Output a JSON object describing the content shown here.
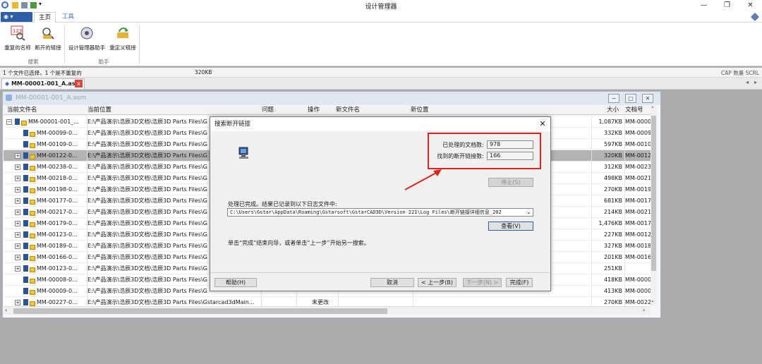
{
  "window": {
    "title": "设计管理器",
    "min": "—",
    "max": "❐",
    "close": "✕"
  },
  "ribbon": {
    "tabs": [
      "主页",
      "工具"
    ],
    "buttons": [
      "重复的名称",
      "断开的链接",
      "设计管理器助手",
      "重定义链接"
    ],
    "groups": [
      "搜索",
      "助手"
    ]
  },
  "status": {
    "selection": "1 个文件已选择，1 个是不重复的",
    "size": "320KB",
    "indicators": "CAP 数量 SCRL"
  },
  "doc_tab": {
    "label": "MM-00001-001_A.asm",
    "close": "x"
  },
  "inner_window": {
    "title": "MM-00001-001_A.asm"
  },
  "columns": [
    "当前文件名",
    "当前位置",
    "问题",
    "操作",
    "新文件名",
    "新位置",
    "大小",
    "文档号"
  ],
  "rows": [
    {
      "name": "MM-00001-001_...",
      "location": "E:\\产品演示\\浩辰3D文档\\浩辰3D Parts Files\\G",
      "action": "",
      "size": "1,087KB",
      "doc": "MM-0000",
      "indent": 0,
      "exp": "−",
      "sel": false
    },
    {
      "name": "MM-00099-0...",
      "location": "E:\\产品演示\\浩辰3D文档\\浩辰3D Parts Files\\G",
      "action": "",
      "size": "332KB",
      "doc": "MM-0009",
      "indent": 1,
      "exp": "",
      "sel": false
    },
    {
      "name": "MM-00109-0...",
      "location": "E:\\产品演示\\浩辰3D文档\\浩辰3D Parts Files\\G",
      "action": "",
      "size": "597KB",
      "doc": "MM-0010",
      "indent": 1,
      "exp": "",
      "sel": false
    },
    {
      "name": "MM-00122-0...",
      "location": "E:\\产品演示\\浩辰3D文档\\浩辰3D Parts Files\\G",
      "action": "",
      "size": "320KB",
      "doc": "MM-0012",
      "indent": 1,
      "exp": "+",
      "sel": true
    },
    {
      "name": "MM-00238-0...",
      "location": "E:\\产品演示\\浩辰3D文档\\浩辰3D Parts Files\\G",
      "action": "",
      "size": "312KB",
      "doc": "MM-0023",
      "indent": 1,
      "exp": "+",
      "sel": false
    },
    {
      "name": "MM-00218-0...",
      "location": "E:\\产品演示\\浩辰3D文档\\浩辰3D Parts Files\\G",
      "action": "",
      "size": "498KB",
      "doc": "MM-0021",
      "indent": 1,
      "exp": "+",
      "sel": false
    },
    {
      "name": "MM-00198-0...",
      "location": "E:\\产品演示\\浩辰3D文档\\浩辰3D Parts Files\\G",
      "action": "",
      "size": "270KB",
      "doc": "MM-0019",
      "indent": 1,
      "exp": "+",
      "sel": false
    },
    {
      "name": "MM-00177-0...",
      "location": "E:\\产品演示\\浩辰3D文档\\浩辰3D Parts Files\\G",
      "action": "",
      "size": "681KB",
      "doc": "MM-0017",
      "indent": 1,
      "exp": "+",
      "sel": false
    },
    {
      "name": "MM-00217-0...",
      "location": "E:\\产品演示\\浩辰3D文档\\浩辰3D Parts Files\\G",
      "action": "",
      "size": "214KB",
      "doc": "MM-0021",
      "indent": 1,
      "exp": "+",
      "sel": false
    },
    {
      "name": "MM-00179-0...",
      "location": "E:\\产品演示\\浩辰3D文档\\浩辰3D Parts Files\\G",
      "action": "",
      "size": "1,476KB",
      "doc": "MM-0017",
      "indent": 1,
      "exp": "+",
      "sel": false
    },
    {
      "name": "MM-00123-0...",
      "location": "E:\\产品演示\\浩辰3D文档\\浩辰3D Parts Files\\G",
      "action": "",
      "size": "227KB",
      "doc": "MM-0012",
      "indent": 1,
      "exp": "+",
      "sel": false
    },
    {
      "name": "MM-00189-0...",
      "location": "E:\\产品演示\\浩辰3D文档\\浩辰3D Parts Files\\G",
      "action": "",
      "size": "327KB",
      "doc": "MM-0018",
      "indent": 1,
      "exp": "+",
      "sel": false
    },
    {
      "name": "MM-00166-0...",
      "location": "E:\\产品演示\\浩辰3D文档\\浩辰3D Parts Files\\G",
      "action": "",
      "size": "201KB",
      "doc": "MM-0016",
      "indent": 1,
      "exp": "+",
      "sel": false
    },
    {
      "name": "MM-00123-0...",
      "location": "E:\\产品演示\\浩辰3D文档\\浩辰3D Parts Files\\G",
      "action": "",
      "size": "251KB",
      "doc": "",
      "indent": 1,
      "exp": "+",
      "sel": false
    },
    {
      "name": "MM-00008-0...",
      "location": "E:\\产品演示\\浩辰3D文档\\浩辰3D Parts Files\\G",
      "action": "",
      "size": "418KB",
      "doc": "MM-0000",
      "indent": 1,
      "exp": "",
      "sel": false
    },
    {
      "name": "MM-00009-0...",
      "location": "E:\\产品演示\\浩辰3D文档\\浩辰3D Parts Files\\G",
      "action": "",
      "size": "413KB",
      "doc": "MM-0000",
      "indent": 1,
      "exp": "",
      "sel": false
    },
    {
      "name": "MM-00227-0...",
      "location": "E:\\产品演示\\浩辰3D文档\\浩辰3D Parts Files\\Gstarcad3dMain...",
      "action": "未更改",
      "size": "270KB",
      "doc": "MM-0022",
      "indent": 1,
      "exp": "+",
      "sel": false
    }
  ],
  "dialog": {
    "title": "搜索断开链接",
    "processed_label": "已处理的文档数:",
    "processed_value": "978",
    "found_label": "找到的断开链接数:",
    "found_value": "166",
    "stop": "停止(S)",
    "done_msg": "处理已完成。结果已记录到以下日志文件中:",
    "log_path": "C:\\Users\\Gstar\\AppData\\Roaming\\Gstarsoft\\GstarCAD3D\\Version 221\\Log Files\\断开链接详细信息_202",
    "view": "查看(V)",
    "hint": "单击“完成”结束向导，或者单击“上一步”开始另一搜索。",
    "help": "帮助(H)",
    "cancel": "取消",
    "back": "< 上一步(B)",
    "next": "下一步(N) >",
    "finish": "完成(F)"
  },
  "colors": {
    "highlight": "#e0241b",
    "selected_row": "#b3b3b3",
    "app_button": "#2d5fa8"
  }
}
